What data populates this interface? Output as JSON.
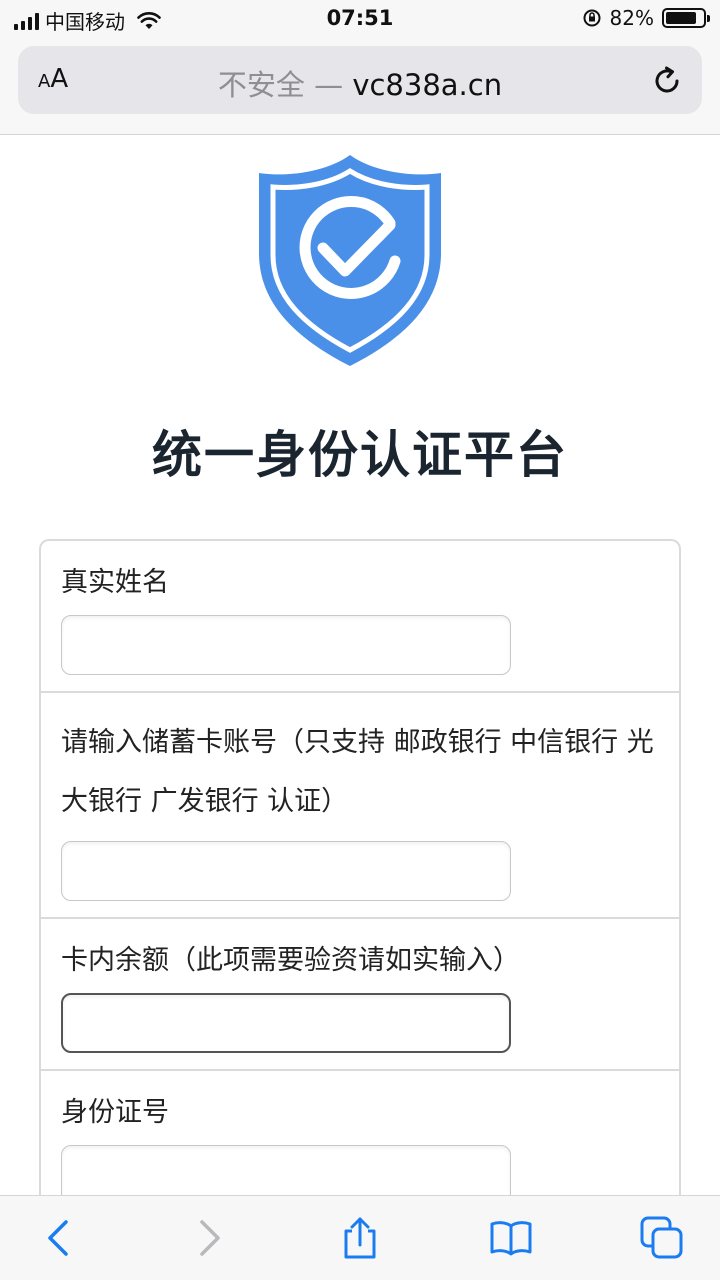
{
  "status_bar": {
    "carrier": "中国移动",
    "time": "07:51",
    "battery_percent": "82%",
    "battery_level": 0.82
  },
  "browser": {
    "aa_label_small": "A",
    "aa_label_large": "A",
    "url_security": "不安全 —",
    "url_domain": "vc838a.cn"
  },
  "page": {
    "title": "统一身份认证平台",
    "form": {
      "fields": [
        {
          "label": "真实姓名",
          "value": ""
        },
        {
          "label": "请输入储蓄卡账号（只支持 邮政银行 中信银行 光大银行 广发银行 认证）",
          "value": ""
        },
        {
          "label": "卡内余额（此项需要验资请如实输入）",
          "value": ""
        },
        {
          "label": "身份证号",
          "value": ""
        }
      ]
    }
  },
  "colors": {
    "shield_blue": "#4a90e8",
    "ios_blue": "#1a7cf0",
    "title_dark": "#1a2530"
  },
  "icons": {
    "back": "chevron-left-icon",
    "forward": "chevron-right-icon",
    "share": "share-icon",
    "bookmarks": "book-icon",
    "tabs": "tabs-icon",
    "reload": "reload-icon",
    "logo": "shield-check-icon"
  }
}
